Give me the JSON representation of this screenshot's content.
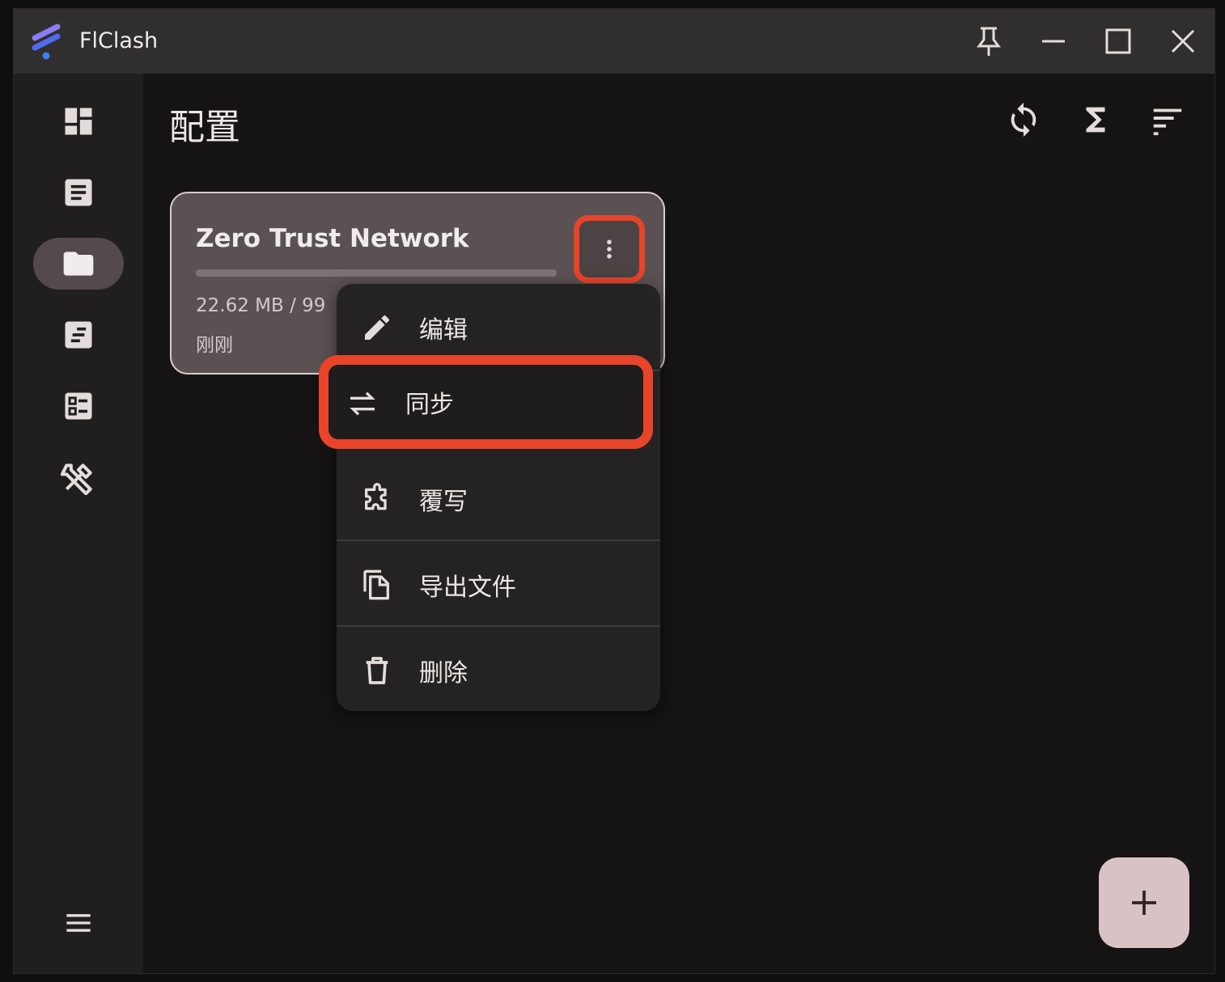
{
  "window": {
    "title": "FlClash"
  },
  "titlebar_buttons": [
    {
      "icon": "pin-icon"
    },
    {
      "icon": "minimize-icon"
    },
    {
      "icon": "maximize-icon"
    },
    {
      "icon": "close-icon"
    }
  ],
  "sidebar": {
    "items": [
      {
        "icon": "dashboard-icon",
        "active": false
      },
      {
        "icon": "article-icon",
        "active": false
      },
      {
        "icon": "folder-icon",
        "active": true
      },
      {
        "icon": "logs-icon",
        "active": false
      },
      {
        "icon": "checklist-icon",
        "active": false
      },
      {
        "icon": "tools-icon",
        "active": false
      }
    ],
    "menu_icon": "menu-icon"
  },
  "header": {
    "title": "配置",
    "actions": [
      "sync-icon",
      "sigma-icon",
      "sort-icon"
    ]
  },
  "profile": {
    "name": "Zero Trust Network",
    "usage": "22.62 MB / 99",
    "progress": 0.0,
    "updated": "刚刚"
  },
  "menu": {
    "items": [
      {
        "label": "编辑",
        "icon": "edit-icon"
      },
      {
        "label": "同步",
        "icon": "swap-icon"
      },
      {
        "label": "覆写",
        "icon": "puzzle-icon"
      },
      {
        "label": "导出文件",
        "icon": "copy-file-icon"
      },
      {
        "label": "删除",
        "icon": "trash-icon"
      }
    ]
  },
  "fab": {
    "icon": "plus-icon"
  },
  "colors": {
    "highlight": "#e8442a",
    "fab": "#d9c2c4",
    "card": "#5a5152"
  }
}
